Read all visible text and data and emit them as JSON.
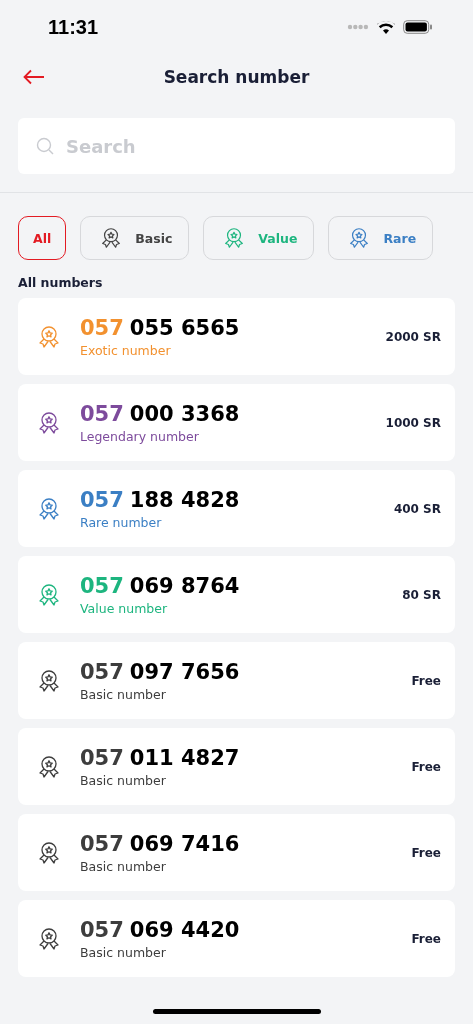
{
  "status_bar": {
    "time": "11:31"
  },
  "header": {
    "title": "Search number"
  },
  "search": {
    "placeholder": "Search"
  },
  "filters": [
    {
      "label": "All",
      "selected": true,
      "kind": "plain",
      "color": "#e31b23"
    },
    {
      "label": "Basic",
      "selected": false,
      "kind": "medal",
      "color": "#444444"
    },
    {
      "label": "Value",
      "selected": false,
      "kind": "medal",
      "color": "#1db57f"
    },
    {
      "label": "Rare",
      "selected": false,
      "kind": "medal",
      "color": "#3b7fc4"
    }
  ],
  "section_title": "All numbers",
  "numbers": [
    {
      "prefix": "057",
      "number": "055 6565",
      "tier": "Exotic number",
      "price": "2000 SR",
      "color": "#f2912f"
    },
    {
      "prefix": "057",
      "number": "000 3368",
      "tier": "Legendary number",
      "price": "1000 SR",
      "color": "#7d4b9c"
    },
    {
      "prefix": "057",
      "number": "188 4828",
      "tier": "Rare number",
      "price": "400 SR",
      "color": "#3b7fc4"
    },
    {
      "prefix": "057",
      "number": "069 8764",
      "tier": "Value number",
      "price": "80 SR",
      "color": "#1db57f"
    },
    {
      "prefix": "057",
      "number": "097 7656",
      "tier": "Basic number",
      "price": "Free",
      "color": "#3d3d3d"
    },
    {
      "prefix": "057",
      "number": "011 4827",
      "tier": "Basic number",
      "price": "Free",
      "color": "#3d3d3d"
    },
    {
      "prefix": "057",
      "number": "069 7416",
      "tier": "Basic number",
      "price": "Free",
      "color": "#3d3d3d"
    },
    {
      "prefix": "057",
      "number": "069 4420",
      "tier": "Basic number",
      "price": "Free",
      "color": "#3d3d3d"
    }
  ]
}
